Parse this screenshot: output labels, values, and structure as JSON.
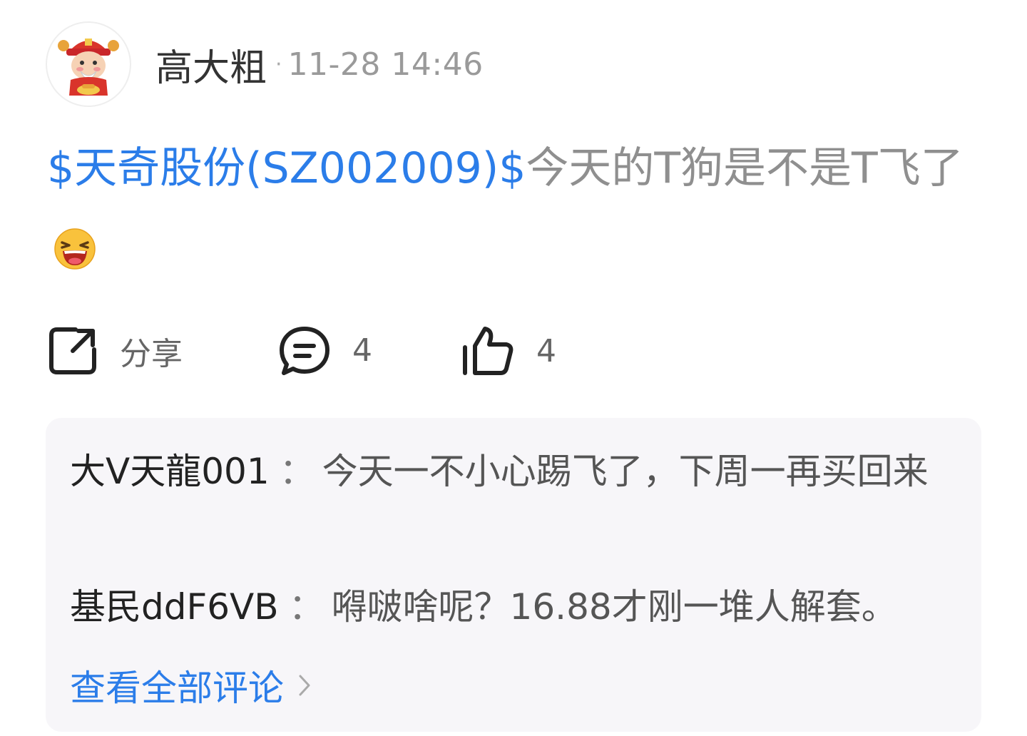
{
  "post": {
    "author": "高大粗",
    "separator": "·",
    "timestamp": "11-28 14:46",
    "stock_link": "$天奇股份(SZ002009)$",
    "text": "今天的T狗是不是T飞了"
  },
  "actions": {
    "share_label": "分享",
    "comment_count": "4",
    "like_count": "4"
  },
  "comments": [
    {
      "author": "大V天龍001",
      "separator": "：",
      "text": "今天一不小心踢飞了，下周一再买回来"
    },
    {
      "author": "基民ddF6VB",
      "separator": "：",
      "text": "嘚啵啥呢？16.88才刚一堆人解套。"
    }
  ],
  "view_all_comments": "查看全部评论",
  "colors": {
    "link": "#2b7de9",
    "text_muted": "#8f8f8f",
    "comment_bg": "#f7f6f9"
  }
}
